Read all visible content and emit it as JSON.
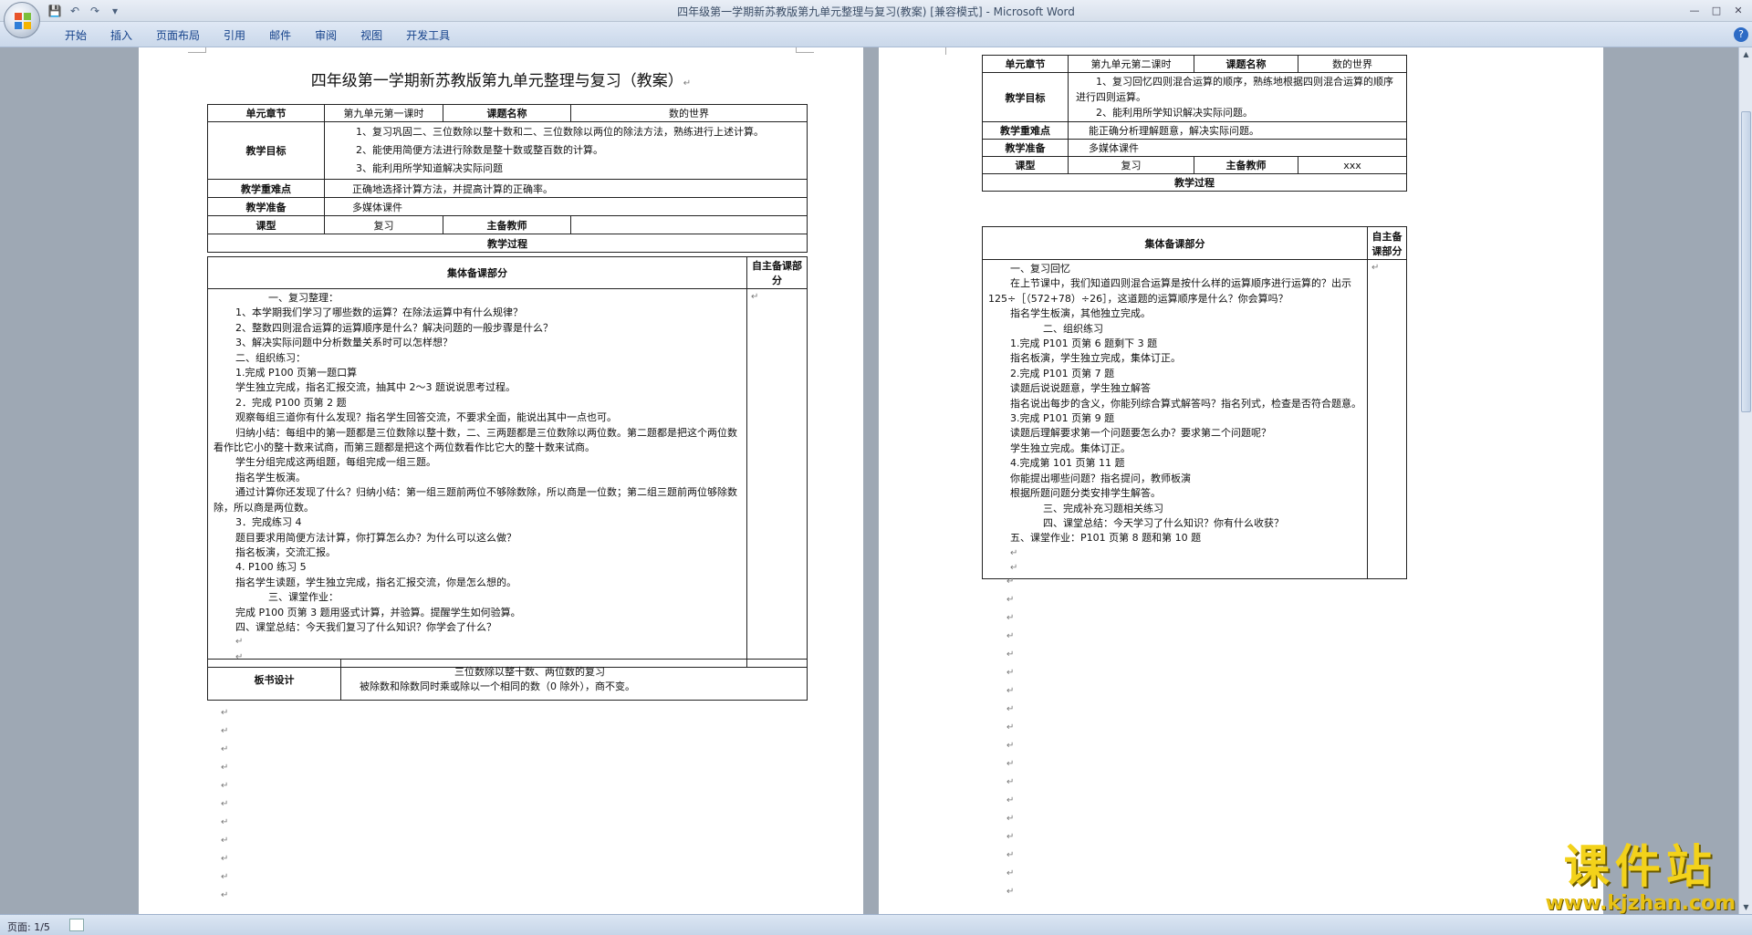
{
  "window": {
    "title": "四年级第一学期新苏教版第九单元整理与复习(教案) [兼容模式]",
    "app": "Microsoft Word",
    "separator": " - "
  },
  "ribbon_tabs": [
    "开始",
    "插入",
    "页面布局",
    "引用",
    "邮件",
    "审阅",
    "视图",
    "开发工具"
  ],
  "status": {
    "page": "页面: 1/5"
  },
  "p1": {
    "title": "四年级第一学期新苏教版第九单元整理与复习（教案）",
    "unit_label": "单元章节",
    "unit_value": "第九单元第一课时",
    "topic_label": "课题名称",
    "topic_value": "数的世界",
    "goal_label": "教学目标",
    "goals": [
      "1、复习巩固二、三位数除以整十数和二、三位数除以两位的除法方法，熟练进行上述计算。",
      "2、能使用简便方法进行除数是整十数或整百数的计算。",
      "3、能利用所学知道解决实际问题"
    ],
    "key_label": "教学重难点",
    "key_value": "正确地选择计算方法，并提高计算的正确率。",
    "prep_label": "教学准备",
    "prep_value": "多媒体课件",
    "type_label": "课型",
    "type_value": "复习",
    "teacher_label": "主备教师",
    "teacher_value": "",
    "process_label": "教学过程",
    "group_label": "集体备课部分",
    "self_label": "自主备课部分",
    "body": [
      "一、复习整理：",
      "1、本学期我们学习了哪些数的运算？在除法运算中有什么规律？",
      "2、整数四则混合运算的运算顺序是什么？解决问题的一般步骤是什么？",
      "3、解决实际问题中分析数量关系时可以怎样想？",
      "二、组织练习：",
      "1.完成 P100 页第一题口算",
      "学生独立完成，指名汇报交流，抽其中 2～3 题说说思考过程。",
      "2．完成 P100 页第 2 题",
      "观察每组三道你有什么发现？指名学生回答交流，不要求全面，能说出其中一点也可。",
      "归纳小结：每组中的第一题都是三位数除以整十数，二、三两题都是三位数除以两位数。第二题都是把这个两位数看作比它小的整十数来试商，而第三题都是把这个两位数看作比它大的整十数来试商。",
      "学生分组完成这两组题，每组完成一组三题。",
      "指名学生板演。",
      "通过计算你还发现了什么？归纳小结：第一组三题前两位不够除数除，所以商是一位数；第二组三题前两位够除数除，所以商是两位数。",
      "3．完成练习 4",
      "题目要求用简便方法计算，你打算怎么办？为什么可以这么做？",
      "指名板演，交流汇报。",
      "4. P100 练习 5",
      "指名学生读题，学生独立完成，指名汇报交流，你是怎么想的。",
      "三、课堂作业：",
      "完成 P100 页第 3 题用竖式计算，并验算。提醒学生如何验算。",
      "四、课堂总结：今天我们复习了什么知识？你学会了什么？"
    ],
    "board_label": "板书设计",
    "board": [
      "三位数除以整十数、两位数的复习",
      "被除数和除数同时乘或除以一个相同的数（0 除外），商不变。"
    ]
  },
  "p2": {
    "unit_label": "单元章节",
    "unit_value": "第九单元第二课时",
    "topic_label": "课题名称",
    "topic_value": "数的世界",
    "goal_label": "教学目标",
    "goals": [
      "1、复习回忆四则混合运算的顺序，熟练地根据四则混合运算的顺序进行四则运算。",
      "2、能利用所学知识解决实际问题。"
    ],
    "key_label": "教学重难点",
    "key_value": "能正确分析理解题意，解决实际问题。",
    "prep_label": "教学准备",
    "prep_value": "多媒体课件",
    "type_label": "课型",
    "type_value": "复习",
    "teacher_label": "主备教师",
    "teacher_value": "xxx",
    "process_label": "教学过程",
    "group_label": "集体备课部分",
    "self_label": "自主备课部分",
    "body": [
      "一、复习回忆",
      "在上节课中，我们知道四则混合运算是按什么样的运算顺序进行运算的？出示 125÷［（572+78）÷26］，这道题的运算顺序是什么？你会算吗？",
      "指名学生板演，其他独立完成。",
      "二、组织练习",
      "1.完成 P101 页第 6 题剩下 3 题",
      "指名板演，学生独立完成，集体订正。",
      "2.完成 P101 页第 7 题",
      "读题后说说题意，学生独立解答",
      "指名说出每步的含义，你能列综合算式解答吗？指名列式，检查是否符合题意。",
      "3.完成 P101 页第 9 题",
      "读题后理解要求第一个问题要怎么办？要求第二个问题呢？",
      "学生独立完成。集体订正。",
      "4.完成第 101 页第 11 题",
      "你能提出哪些问题？指名提问，教师板演",
      "根据所题问题分类安排学生解答。",
      "三、完成补充习题相关练习",
      "四、课堂总结：今天学习了什么知识？你有什么收获？",
      "五、课堂作业：P101 页第 8 题和第 10 题"
    ]
  },
  "watermark": {
    "big": "课件站",
    "small": "www.kjzhan.com"
  },
  "colors": {
    "ribbon_text": "#15428b",
    "watermark": "#f3d21a",
    "workspace": "#9ea8b4"
  }
}
